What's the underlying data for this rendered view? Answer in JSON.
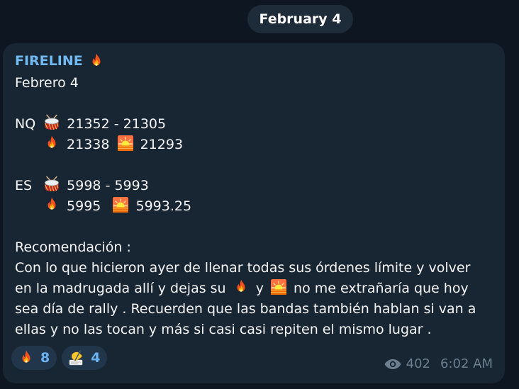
{
  "date_separator": "February 4",
  "message": {
    "sender": "FIRELINE",
    "sender_icon": "fire-icon",
    "lines": {
      "date_line": "Febrero 4",
      "nq_label": "NQ",
      "nq_range": "21352 - 21305",
      "nq_fire_value": "21338",
      "nq_sunset_value": "21293",
      "es_label": "ES",
      "es_range": "5998 - 5993",
      "es_fire_value": "5995",
      "es_sunset_value": "5993.25",
      "rec_title": "Recomendación :",
      "p1": "Con lo que hicieron ayer de llenar todas sus órdenes límite y volver",
      "p2a": "en la madrugada allí y dejas su",
      "p2b": "y",
      "p2c": "no me extrañaría que hoy",
      "p3": "sea día de rally . Recuerden que las bandas también hablan si van a",
      "p4": "ellas y no las tocan y más si casi casi repiten el mismo lugar ."
    },
    "icons": [
      "fire-icon",
      "drum-icon",
      "sunset-icon",
      "writing-hand-icon",
      "eye-icon"
    ],
    "reactions": [
      {
        "icon": "fire-icon",
        "count": "8"
      },
      {
        "icon": "writing-hand-icon",
        "count": "4"
      }
    ],
    "views": "402",
    "time": "6:02 AM"
  },
  "colors": {
    "background": "#0e1621",
    "bubble": "#182533",
    "sender": "#71baf2",
    "reaction_bg": "#22364b",
    "reaction_count": "#6ab3f3",
    "meta": "#6d7f8f"
  }
}
